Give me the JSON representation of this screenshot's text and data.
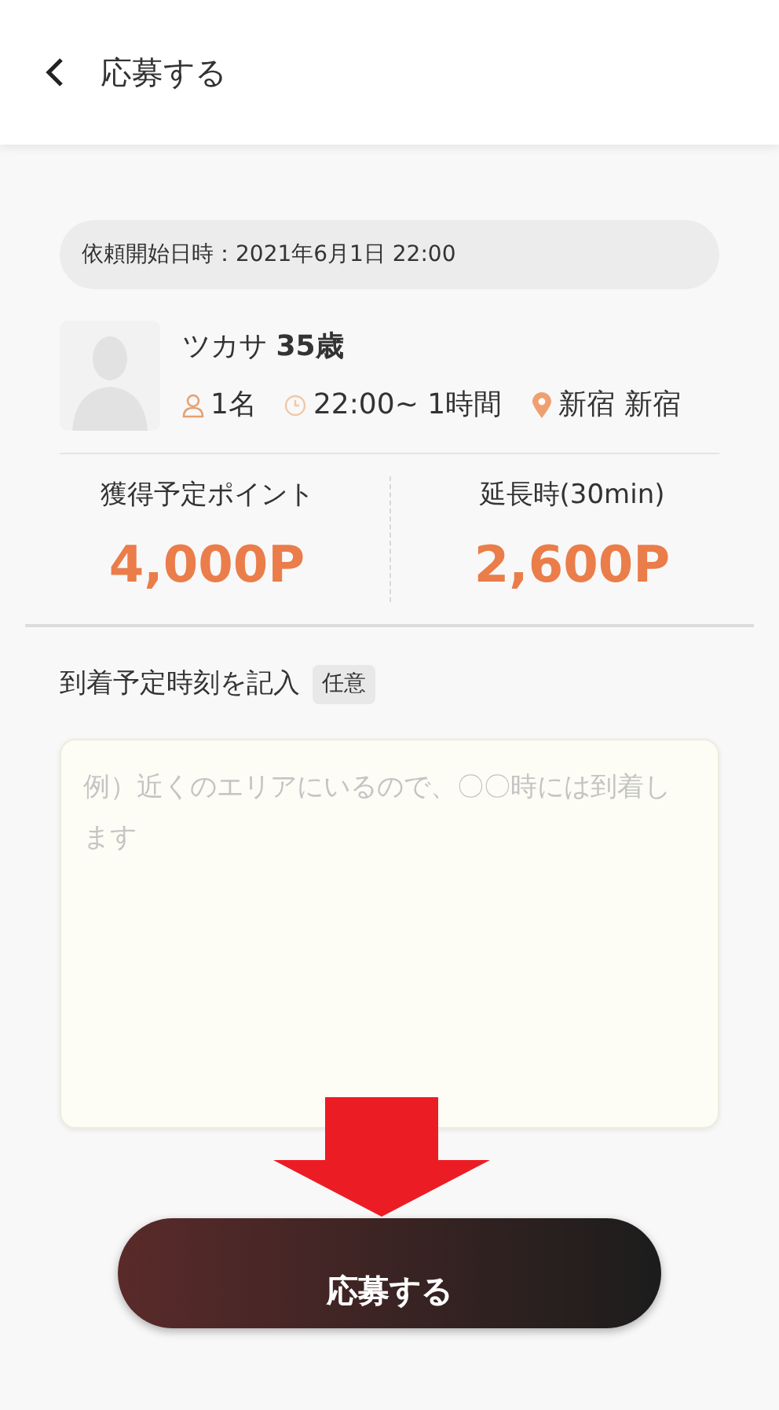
{
  "header": {
    "title": "応募する"
  },
  "request": {
    "start_label": "依頼開始日時：2021年6月1日 22:00"
  },
  "profile": {
    "name": "ツカサ",
    "age": "35歳",
    "people": "1名",
    "time": "22:00~ 1時間",
    "location": "新宿 新宿"
  },
  "points": [
    {
      "label": "獲得予定ポイント",
      "value": "4,000P"
    },
    {
      "label": "延長時(30min)",
      "value": "2,600P"
    }
  ],
  "arrival": {
    "label": "到着予定時刻を記入",
    "badge": "任意",
    "placeholder": "例）近くのエリアにいるので、〇〇時には到着します"
  },
  "submit": {
    "label": "応募する"
  }
}
